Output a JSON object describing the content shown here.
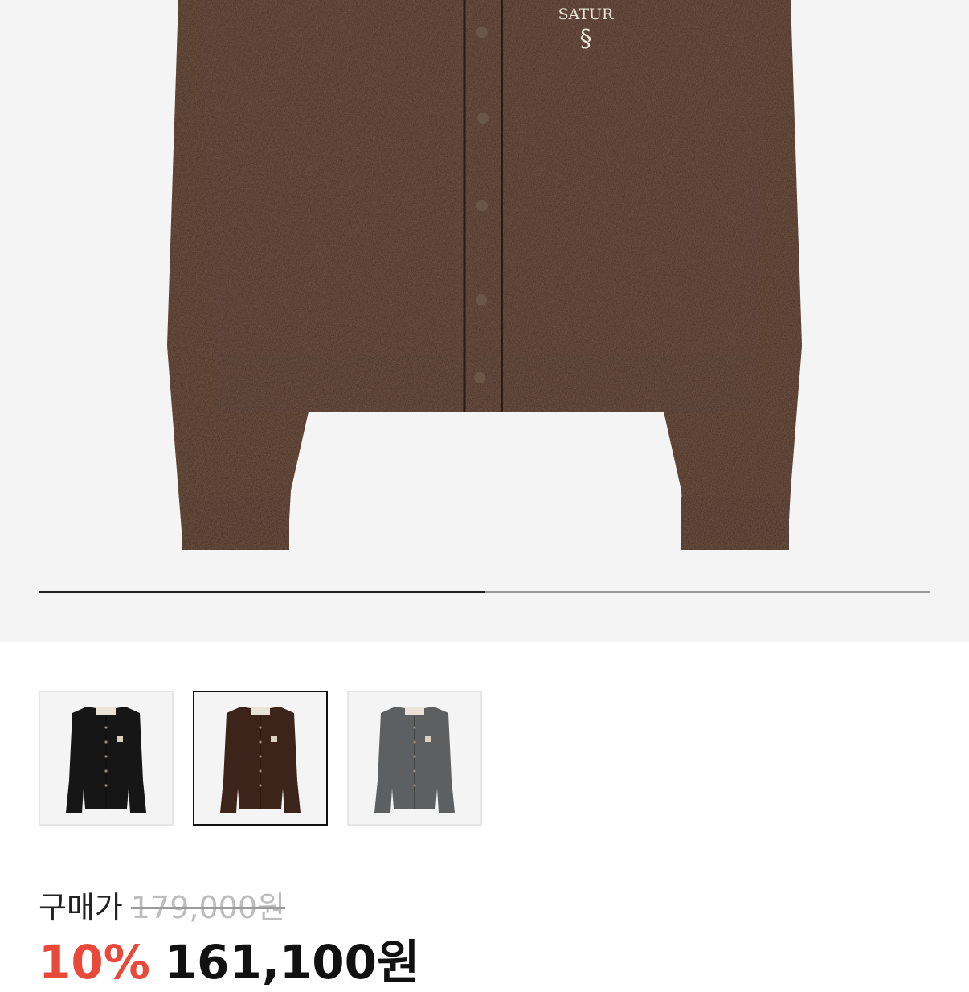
{
  "gallery": {
    "main_image_alt": "brown wool cardigan",
    "brand_embroidery": "SATUR",
    "progress": 0.5,
    "progress_color": "#222222",
    "track_color": "#9a9a9a"
  },
  "thumbnails": [
    {
      "color_name": "black",
      "fill": "#161616",
      "selected": false
    },
    {
      "color_name": "brown",
      "fill": "#3d241a",
      "selected": true
    },
    {
      "color_name": "gray",
      "fill": "#5d5f60",
      "selected": false
    }
  ],
  "price": {
    "label": "구매가",
    "original": "179,000원",
    "discount": "10%",
    "discount_color": "#e8493b",
    "sale": "161,100원"
  }
}
